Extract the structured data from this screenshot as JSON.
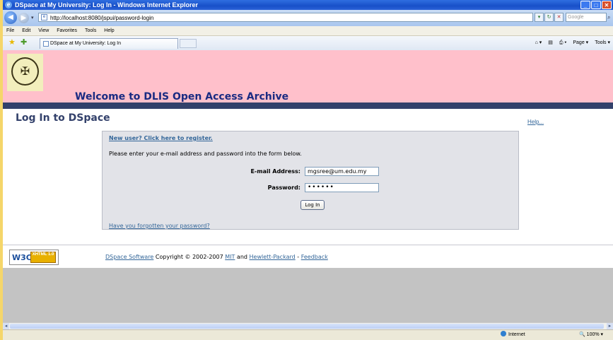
{
  "window": {
    "title": "DSpace at My University: Log In - Windows Internet Explorer",
    "icon": "ie-icon",
    "controls": [
      "_",
      "□",
      "✕"
    ]
  },
  "address_bar": {
    "url": "http://localhost:8080/jspui/password-login",
    "search_placeholder": "Google",
    "refresh_glyph": "↻",
    "stop_glyph": "✕",
    "go_glyph": "▾"
  },
  "menu": [
    "File",
    "Edit",
    "View",
    "Favorites",
    "Tools",
    "Help"
  ],
  "favorites_bar": {
    "tab_label": "DSpace at My University: Log In",
    "commands": [
      "Page ▾",
      "Tools ▾"
    ]
  },
  "page": {
    "welcome": "Welcome to DLIS Open Access Archive",
    "title": "Log In to DSpace",
    "help": "Help...",
    "register_link": "New user? Click here to register.",
    "instructions": "Please enter your e-mail address and password into the form below.",
    "email_label": "E-mail Address:",
    "email_value": "mgsree@um.edu.my",
    "password_label": "Password:",
    "password_value": "••••••",
    "login_button": "Log In",
    "forgot_link": "Have you forgotten your password?"
  },
  "footer": {
    "w3c_text": "W3C",
    "xhtml_badge": "XHTML 1.0",
    "dspace_link": "DSpace Software",
    "copyright": " Copyright © 2002-2007 ",
    "mit": "MIT",
    "and": " and ",
    "hp": "Hewlett-Packard",
    "dash": " - ",
    "feedback": "Feedback"
  },
  "status_bar": {
    "zone": "Internet",
    "zoom": "100%"
  },
  "colors": {
    "header_bg": "#ffc0cb",
    "header_stripe": "#33416b",
    "welcome_text": "#1a2b82",
    "link": "#336699",
    "form_bg": "#e2e3e8"
  }
}
